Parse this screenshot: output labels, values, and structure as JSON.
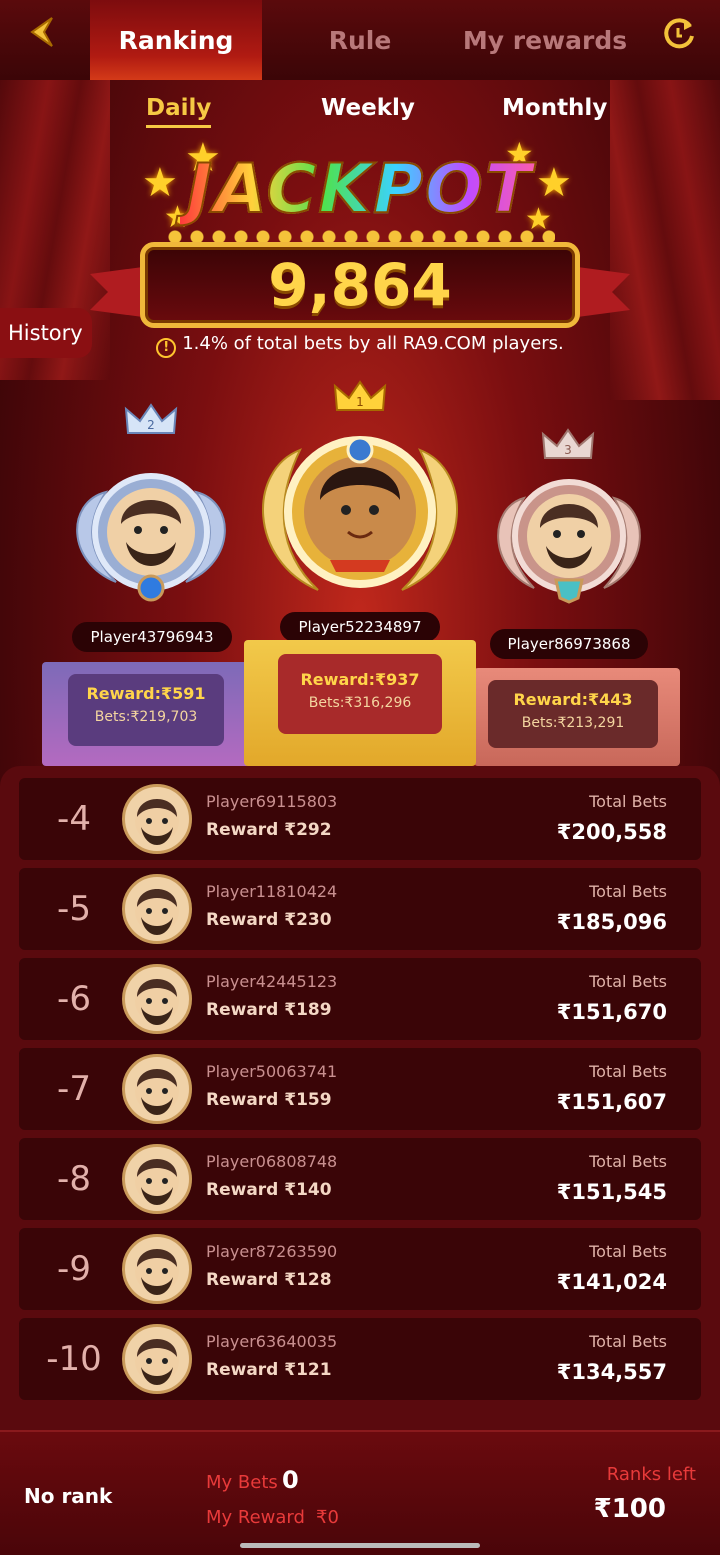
{
  "nav": {
    "tabs": [
      {
        "label": "Ranking",
        "active": true
      },
      {
        "label": "Rule",
        "active": false
      },
      {
        "label": "My rewards",
        "active": false
      }
    ]
  },
  "period": {
    "tabs": [
      {
        "label": "Daily",
        "active": true
      },
      {
        "label": "Weekly",
        "active": false
      },
      {
        "label": "Monthly",
        "active": false
      }
    ]
  },
  "jackpot": {
    "title": "JACKPOT",
    "value": "9,864",
    "note_icon": "!",
    "note": "1.4% of total bets by all RA9.COM players."
  },
  "history_label": "History",
  "podium": [
    {
      "rank": "1",
      "player": "Player52234897",
      "reward": "Reward:₹937",
      "bets": "Bets:₹316,296"
    },
    {
      "rank": "2",
      "player": "Player43796943",
      "reward": "Reward:₹591",
      "bets": "Bets:₹219,703"
    },
    {
      "rank": "3",
      "player": "Player86973868",
      "reward": "Reward:₹443",
      "bets": "Bets:₹213,291"
    }
  ],
  "list": [
    {
      "rank": "-4",
      "player": "Player69115803",
      "reward": "Reward ₹292",
      "total_label": "Total Bets",
      "total": "₹200,558"
    },
    {
      "rank": "-5",
      "player": "Player11810424",
      "reward": "Reward ₹230",
      "total_label": "Total Bets",
      "total": "₹185,096"
    },
    {
      "rank": "-6",
      "player": "Player42445123",
      "reward": "Reward ₹189",
      "total_label": "Total Bets",
      "total": "₹151,670"
    },
    {
      "rank": "-7",
      "player": "Player50063741",
      "reward": "Reward ₹159",
      "total_label": "Total Bets",
      "total": "₹151,607"
    },
    {
      "rank": "-8",
      "player": "Player06808748",
      "reward": "Reward ₹140",
      "total_label": "Total Bets",
      "total": "₹151,545"
    },
    {
      "rank": "-9",
      "player": "Player87263590",
      "reward": "Reward ₹128",
      "total_label": "Total Bets",
      "total": "₹141,024"
    },
    {
      "rank": "-10",
      "player": "Player63640035",
      "reward": "Reward ₹121",
      "total_label": "Total Bets",
      "total": "₹134,557"
    }
  ],
  "bottom": {
    "no_rank": "No rank",
    "my_bets_label": "My Bets",
    "my_bets_value": "0",
    "my_reward_label": "My Reward",
    "my_reward_value": "₹0",
    "ranks_left_label": "Ranks left",
    "ranks_left_value": "₹100"
  },
  "colors": {
    "accent_gold": "#f6c944",
    "bg_dark": "#3a0508",
    "highlight_red": "#e83a3a"
  },
  "icons": [
    "back-arrow-icon",
    "refresh-icon",
    "crown-icon",
    "star-icon",
    "info-icon"
  ]
}
